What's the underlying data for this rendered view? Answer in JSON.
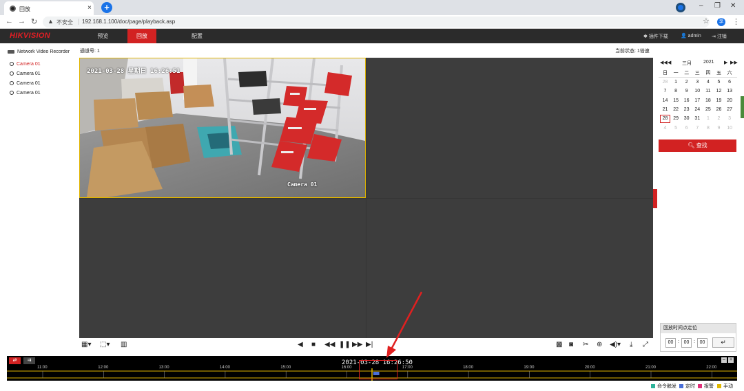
{
  "browser": {
    "tab_title": "回放",
    "tab_close": "×",
    "new_tab": "+",
    "not_secure": "不安全",
    "url": "192.168.1.100/doc/page/playback.asp",
    "extension_badge": "享"
  },
  "app": {
    "logo_red": "HIKVISION",
    "nav": [
      {
        "label": "预览"
      },
      {
        "label": "回放"
      },
      {
        "label": "配置"
      }
    ],
    "plugin_download": "插件下载",
    "user": "admin",
    "logout": "注销"
  },
  "tree": {
    "root": "Network Video Recorder",
    "cameras": [
      "Camera 01",
      "Camera 01",
      "Camera 01",
      "Camera 01"
    ]
  },
  "channel_label": "通道号: 1",
  "status_label": "当前状态: 1倍速",
  "video": {
    "osd_time": "2021-03-28 星期日 16:26:51",
    "osd_camera": "Camera 01"
  },
  "calendar": {
    "month": "三月",
    "year": "2021",
    "weekdays": [
      "日",
      "一",
      "二",
      "三",
      "四",
      "五",
      "六"
    ],
    "rows": [
      [
        "28",
        "1",
        "2",
        "3",
        "4",
        "5",
        "6"
      ],
      [
        "7",
        "8",
        "9",
        "10",
        "11",
        "12",
        "13"
      ],
      [
        "14",
        "15",
        "16",
        "17",
        "18",
        "19",
        "20"
      ],
      [
        "21",
        "22",
        "23",
        "24",
        "25",
        "26",
        "27"
      ],
      [
        "28",
        "29",
        "30",
        "31",
        "1",
        "2",
        "3"
      ],
      [
        "4",
        "5",
        "6",
        "7",
        "8",
        "9",
        "10"
      ]
    ],
    "selected_day": "28"
  },
  "search_button": "查找",
  "locate": {
    "title": "回放时间点定位",
    "hh": "00",
    "mm": "00",
    "ss": "00",
    "go": "↵"
  },
  "timeline": {
    "current_time": "2021-03-28 16:26:50",
    "ticks": [
      "11:00",
      "12:00",
      "13:00",
      "14:00",
      "15:00",
      "16:00",
      "17:00",
      "18:00",
      "19:00",
      "20:00",
      "21:00",
      "22:00"
    ],
    "record_segment": {
      "start": "16:26",
      "end": "16:32"
    }
  },
  "legend": [
    {
      "label": "命令触发",
      "color": "#2db39a"
    },
    {
      "label": "定时",
      "color": "#4a6fd8"
    },
    {
      "label": "报警",
      "color": "#e0307a"
    },
    {
      "label": "手动",
      "color": "#e0b800"
    }
  ],
  "colors": {
    "accent": "#d22222",
    "header_bg": "#2b2b2b",
    "selected_outline": "#e0b400",
    "timeline_line": "#e0b400"
  }
}
